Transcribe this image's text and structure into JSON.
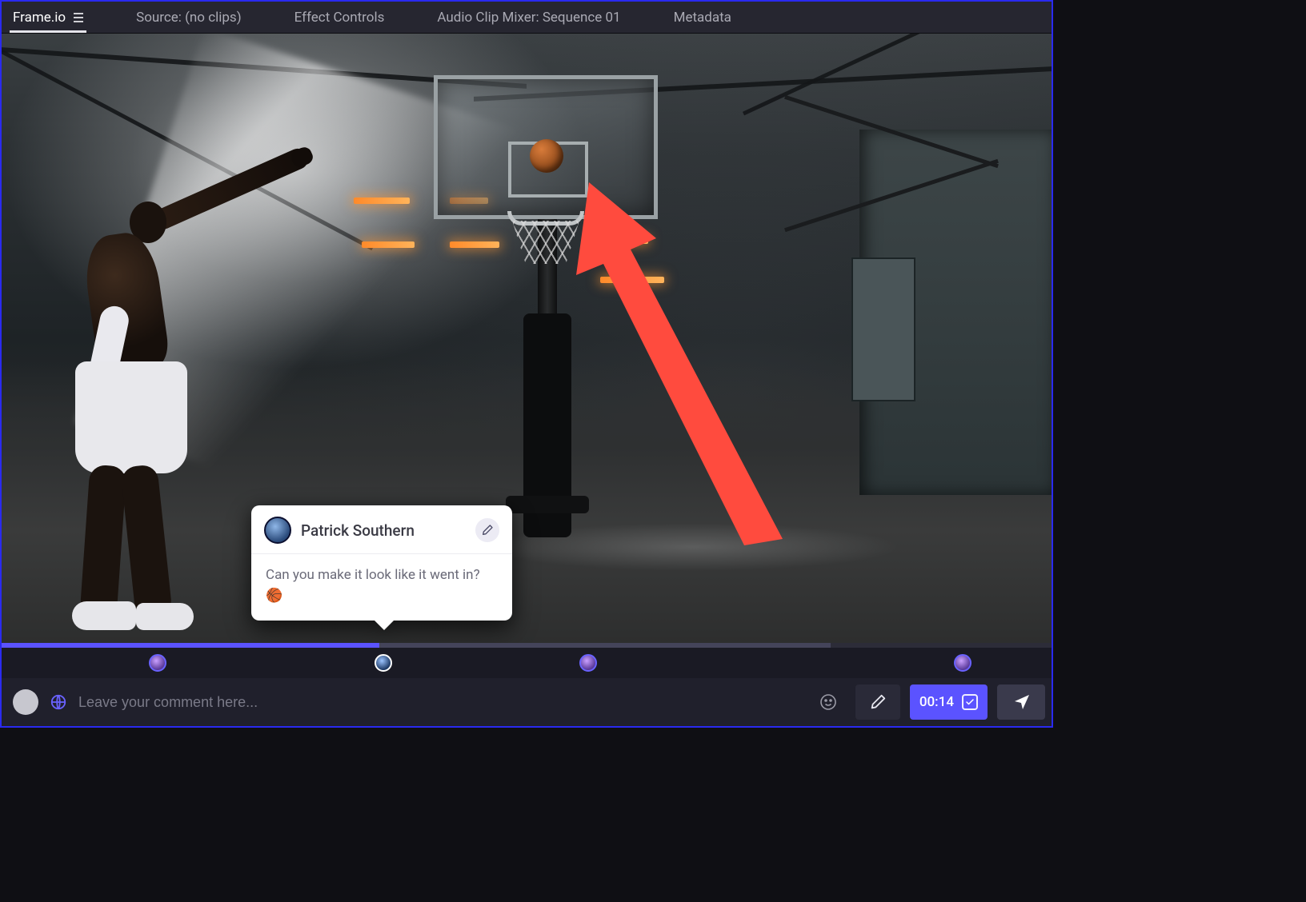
{
  "tabs": {
    "frameio": "Frame.io",
    "source": "Source: (no clips)",
    "effect_controls": "Effect Controls",
    "audio_mixer": "Audio Clip Mixer: Sequence 01",
    "metadata": "Metadata"
  },
  "comment_popup": {
    "author": "Patrick Southern",
    "body": "Can you make it look like it went in? 🏀"
  },
  "commentbar": {
    "placeholder": "Leave your comment here...",
    "timecode": "00:14"
  },
  "colors": {
    "accent": "#5b53ff",
    "panel": "#20202c",
    "tabbar": "#262630"
  }
}
